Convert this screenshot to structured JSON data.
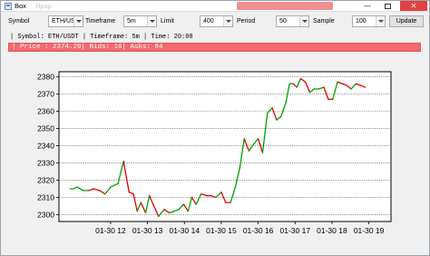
{
  "window": {
    "title": "Box",
    "ghost_text": "Ярар",
    "controls": {
      "minimize": "—",
      "close": "✕"
    }
  },
  "toolbar": {
    "symbol_label": "Symbol",
    "symbol_value": "ETH/USDT",
    "timeframe_label": "Timeframe",
    "timeframe_value": "5m",
    "limit_label": "Limit",
    "limit_value": "400",
    "period_label": "Period",
    "period_value": "50",
    "sample_label": "Sample",
    "sample_value": "100",
    "update_label": "Update"
  },
  "info_line": "| Symbol: ETH/USDT | Timeframe: 5m | Time: 20:08",
  "price_bar": "| Price : 2374.29| Bids: 16| Asks: 84",
  "colors": {
    "up": "#00a000",
    "down": "#e00000",
    "price_bar": "#f26a6d",
    "close_button": "#e04343"
  },
  "chart_data": {
    "type": "line",
    "title": "",
    "xlabel": "",
    "ylabel": "",
    "x_ticks": [
      "01-30 12",
      "01-30 13",
      "01-30 14",
      "01-30 15",
      "01-30 16",
      "01-30 17",
      "01-30 18",
      "01-30 19"
    ],
    "y_ticks": [
      2300,
      2310,
      2320,
      2330,
      2340,
      2350,
      2360,
      2370,
      2380
    ],
    "ylim": [
      2296,
      2383
    ],
    "xlim": [
      10.6,
      19.6
    ],
    "grid": "horizontal",
    "series": [
      {
        "hours": [
          10.9,
          11.0,
          11.1,
          11.25,
          11.4,
          11.55,
          11.7,
          11.85,
          12.0,
          12.1,
          12.2,
          12.35,
          12.5,
          12.62,
          12.72,
          12.82,
          12.95,
          13.05,
          13.15,
          13.3,
          13.45,
          13.6,
          13.72,
          13.85,
          13.98,
          14.1,
          14.2,
          14.32,
          14.45,
          14.6,
          14.72,
          14.85,
          15.0,
          15.12,
          15.25,
          15.38,
          15.5,
          15.62,
          15.75,
          15.88,
          16.0,
          16.12,
          16.25,
          16.38,
          16.5,
          16.62,
          16.75,
          16.85,
          16.95,
          17.05,
          17.15,
          17.28,
          17.4,
          17.52,
          17.65,
          17.78,
          17.9,
          18.02,
          18.15,
          18.28,
          18.4,
          18.52,
          18.65,
          18.78,
          18.9
        ],
        "price": [
          2315,
          2315,
          2316,
          2314,
          2314,
          2315,
          2314,
          2312,
          2316,
          2317,
          2318,
          2331,
          2313,
          2312,
          2302,
          2307,
          2301,
          2311,
          2306,
          2299,
          2303,
          2301,
          2302,
          2303,
          2306,
          2302,
          2310,
          2306,
          2312,
          2311,
          2311,
          2310,
          2313,
          2307,
          2307,
          2316,
          2327,
          2344,
          2337,
          2341,
          2344,
          2336,
          2359,
          2362,
          2355,
          2357,
          2365,
          2376,
          2376,
          2374,
          2379,
          2377,
          2371,
          2373,
          2373,
          2374,
          2367,
          2367,
          2377,
          2376,
          2375,
          2373,
          2376,
          2375,
          2374
        ],
        "colors": [
          "up",
          "up",
          "up",
          "up",
          "down",
          "down",
          "down",
          "up",
          "up",
          "up",
          "up",
          "down",
          "down",
          "down",
          "up",
          "down",
          "up",
          "down",
          "down",
          "up",
          "down",
          "up",
          "up",
          "up",
          "down",
          "up",
          "down",
          "up",
          "down",
          "down",
          "down",
          "up",
          "down",
          "down",
          "up",
          "up",
          "up",
          "down",
          "up",
          "up",
          "down",
          "up",
          "up",
          "down",
          "up",
          "up",
          "up",
          "up",
          "down",
          "up",
          "down",
          "down",
          "up",
          "up",
          "up",
          "down",
          "down",
          "up",
          "down",
          "down",
          "down",
          "up",
          "down",
          "down",
          "down"
        ]
      }
    ]
  }
}
